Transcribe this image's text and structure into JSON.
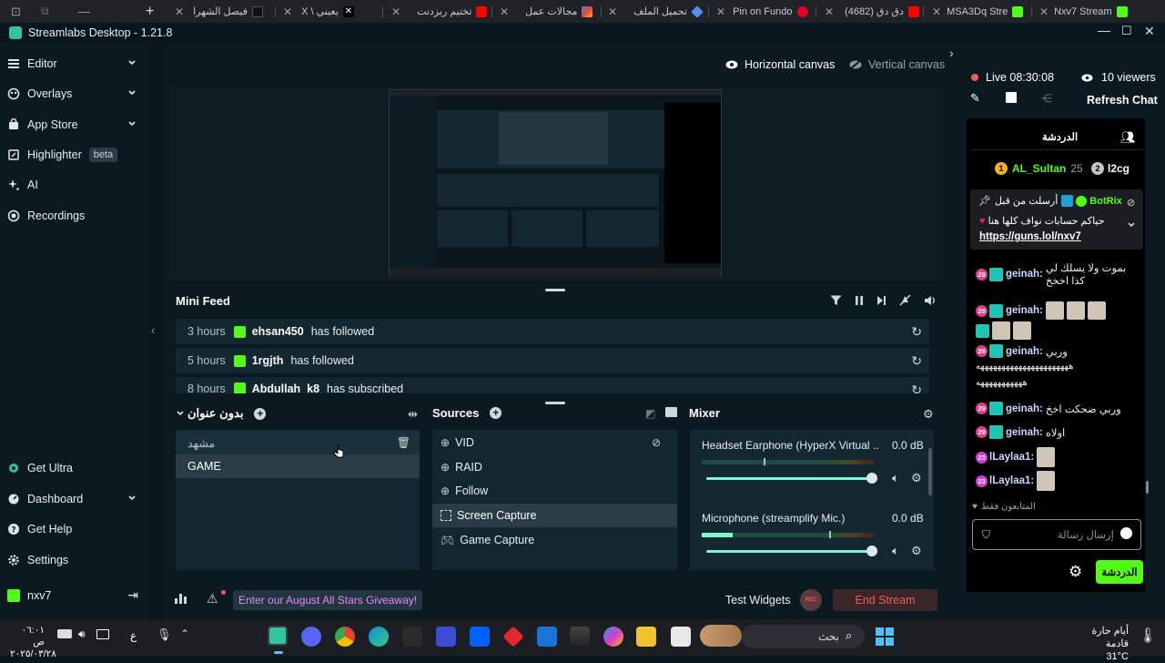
{
  "browser_tabs": [
    {
      "label": "فيصل الشهرا",
      "favicon_color": "#111111"
    },
    {
      "label": "X \\ يعيني",
      "favicon_color": "#000000"
    },
    {
      "label": "تختيم ريزدنت",
      "favicon_color": "#ff0000"
    },
    {
      "label": "مجالات عمل",
      "favicon_color": "#8e44ad"
    },
    {
      "label": "تحميل الملف",
      "favicon_color": "#4a7bd4"
    },
    {
      "label": "Pin on Fundo",
      "favicon_color": "#e60023"
    },
    {
      "label": "(4682) دق دق",
      "favicon_color": "#ff0000"
    },
    {
      "label": "MSA3Dq Stre",
      "favicon_color": "#53fc18"
    },
    {
      "label": "Nxv7 Stream",
      "favicon_color": "#53fc18"
    }
  ],
  "app": {
    "title": "Streamlabs Desktop - 1.21.8"
  },
  "sidebar": {
    "items": [
      {
        "label": "Editor",
        "icon": "editor-icon"
      },
      {
        "label": "Overlays",
        "icon": "overlays-icon"
      },
      {
        "label": "App Store",
        "icon": "app-store-icon"
      },
      {
        "label": "Highlighter",
        "icon": "highlighter-icon",
        "badge": "beta"
      },
      {
        "label": "AI",
        "icon": "ai-icon"
      },
      {
        "label": "Recordings",
        "icon": "recordings-icon"
      }
    ],
    "bottom_items": [
      {
        "label": "Get Ultra",
        "icon": "ultra-icon"
      },
      {
        "label": "Dashboard",
        "icon": "dashboard-icon"
      },
      {
        "label": "Get Help",
        "icon": "help-icon"
      },
      {
        "label": "Settings",
        "icon": "settings-icon"
      }
    ],
    "account": "nxv7"
  },
  "canvas": {
    "horizontal": "Horizontal canvas",
    "vertical": "Vertical canvas"
  },
  "mini_feed": {
    "title": "Mini Feed",
    "rows": [
      {
        "time": "3 hours",
        "user": "ehsan450",
        "action": "has followed"
      },
      {
        "time": "5 hours",
        "user": "1rgjth",
        "action": "has followed"
      },
      {
        "time": "8 hours",
        "user": "Abdullah_k8",
        "action": "has subscribed"
      }
    ]
  },
  "scenes": {
    "title": "بدون عنوان",
    "items": [
      "مشهد",
      "GAME"
    ]
  },
  "sources": {
    "title": "Sources",
    "items": [
      {
        "label": "VID",
        "icon": "globe-icon"
      },
      {
        "label": "RAID",
        "icon": "globe-icon"
      },
      {
        "label": "Follow",
        "icon": "globe-icon"
      },
      {
        "label": "Screen Capture",
        "icon": "screen-capture-icon"
      },
      {
        "label": "Game Capture",
        "icon": "gamepad-icon"
      }
    ],
    "selected": "Screen Capture"
  },
  "mixer": {
    "title": "Mixer",
    "channels": [
      {
        "name": "Headset Earphone (HyperX Virtual ...",
        "level": "0.0 dB",
        "volume": 1.0
      },
      {
        "name": "Microphone (streamplify Mic.)",
        "level": "0.0 dB",
        "volume": 1.0
      }
    ]
  },
  "footer": {
    "promo": "Enter our August All Stars Giveaway!",
    "test_widgets": "Test Widgets",
    "rec": "REC",
    "end_stream": "End Stream"
  },
  "live": {
    "status": "Live 08:30:08",
    "viewers": "10 viewers",
    "refresh": "Refresh Chat"
  },
  "chat": {
    "tab_label": "الدردشة",
    "leaderboard": [
      {
        "rank": "1",
        "user": "AL_Sultan",
        "value": "25"
      },
      {
        "rank": "2",
        "user": "l2cg",
        "value": ""
      }
    ],
    "pinned": {
      "header": "أرسلت من قبل",
      "bot": "BotRix",
      "text": "حياكم حسابات نواف كلها هنا",
      "link": "https://guns.lol/nxv7"
    },
    "messages": [
      {
        "badge": "29",
        "user": "geinah:",
        "text": "بموت ولا يسلك لي كذا اخخخ"
      },
      {
        "badge": "29",
        "user": "geinah:",
        "text": ""
      },
      {
        "badge": "29",
        "user": "geinah:",
        "text": "وربي"
      },
      {
        "badge": "",
        "user": "",
        "text": "ههههههههههههههههههههههه"
      },
      {
        "badge": "",
        "user": "",
        "text": "هههههههههههه"
      },
      {
        "badge": "29",
        "user": "geinah:",
        "text": "وربي ضحكت اخخ"
      },
      {
        "badge": "29",
        "user": "geinah:",
        "text": "اولاه"
      },
      {
        "badge": "23",
        "user": "lLaylaa1:",
        "text": ""
      },
      {
        "badge": "23",
        "user": "lLaylaa1:",
        "text": ""
      }
    ],
    "followers_only": "المتابعون فقط",
    "input_placeholder": "إرسال رسالة",
    "send_label": "الدردشة",
    "accent": "#53fc18"
  },
  "taskbar": {
    "clock_time": "٠٦:٠١ ص",
    "clock_date": "٢٠٢٥/٠٣/٢٨",
    "lang": "ع",
    "search": "بحث",
    "weather_text": "أيام حارة قادمة",
    "weather_temp": "31°C"
  }
}
